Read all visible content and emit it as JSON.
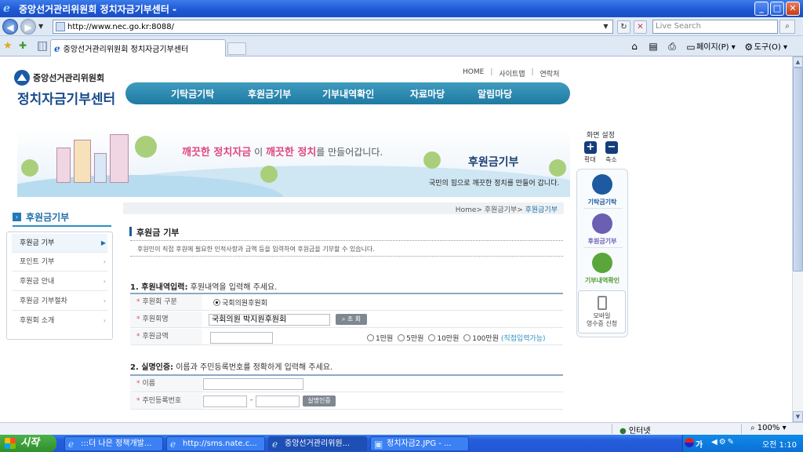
{
  "window": {
    "title": "중앙선거관리위원회 정치자금기부센터 -",
    "min": "_",
    "max": "□",
    "close": "✕"
  },
  "address": {
    "url": "http://www.nec.go.kr:8088/",
    "search_placeholder": "Live Search"
  },
  "tab": {
    "label": "중앙선거관리위원회 정치자금기부센터"
  },
  "command_bar": {
    "page": "페이지(P)",
    "tools": "도구(O)"
  },
  "site": {
    "org_name": "중앙선거관리위원회",
    "title": "정치자금기부센터",
    "util": [
      "HOME",
      "사이트맵",
      "연락처"
    ],
    "gnb": [
      "기탁금기탁",
      "후원금기부",
      "기부내역확인",
      "자료마당",
      "알림마당"
    ]
  },
  "banner": {
    "slogan_hl1": "깨끗한 정치자금",
    "slogan_mid": "이",
    "slogan_hl2": "깨끗한 정치",
    "slogan_tail": "를 만들어갑니다.",
    "title": "후원금기부",
    "subtitle": "국민의 힘으로 깨끗한 정치를 만들어 갑니다."
  },
  "zoom": {
    "label": "화면 설정",
    "in": "확대",
    "out": "축소"
  },
  "quick": [
    {
      "label": "기탁금기탁",
      "color": "#1e5aa0"
    },
    {
      "label": "후원금기부",
      "color": "#6a5fb3"
    },
    {
      "label": "기부내역확인",
      "color": "#5aa63a"
    }
  ],
  "mobile": {
    "line1": "모바일",
    "line2": "영수증 신청"
  },
  "lnb": {
    "title": "후원금기부",
    "items": [
      "후원금 기부",
      "포인트 기부",
      "후원금 안내",
      "후원금 기부절차",
      "후원회 소개"
    ]
  },
  "breadcrumb": {
    "items": [
      "Home",
      "후원금기부",
      "후원금기부"
    ]
  },
  "content": {
    "heading": "후원금 기부",
    "description": "후원인이 직접 후원에 필요한 인적사항과 금액 등을 입력하여 후원금을 기부할 수 있습니다.",
    "section1_title": "1. 후원내역입력:",
    "section1_desc": "후원내역을 입력해 주세요.",
    "section2_title": "2. 실명인증:",
    "section2_desc": "이름과 주민등록번호를 정확하게 입력해 주세요.",
    "fields": {
      "type_label": "후원회 구분",
      "type_value": "국회의원후원회",
      "name_label": "후원회명",
      "name_value": "국회의원 박지원후원회",
      "lookup_btn": "조 회",
      "amount_label": "후원금액",
      "amount_value": "",
      "amount_options": [
        "1만원",
        "5만원",
        "10만원",
        "100만원"
      ],
      "amount_note": "(직접입력가능)",
      "person_name_label": "이름",
      "rrn_label": "주민등록번호",
      "rrn_sep": "-",
      "verify_btn": "실명인증"
    }
  },
  "status": {
    "zone": "인터넷",
    "zoom": "100%"
  },
  "taskbar": {
    "start": "시작",
    "items": [
      {
        "label": ":::더 나은 정책개발...",
        "active": false
      },
      {
        "label": "http://sms.nate.c...",
        "active": false
      },
      {
        "label": "중앙선거관리위원...",
        "active": true
      },
      {
        "label": "정치자금2.JPG - ...",
        "active": false
      }
    ],
    "ime": "가",
    "clock": "오전 1:10"
  }
}
